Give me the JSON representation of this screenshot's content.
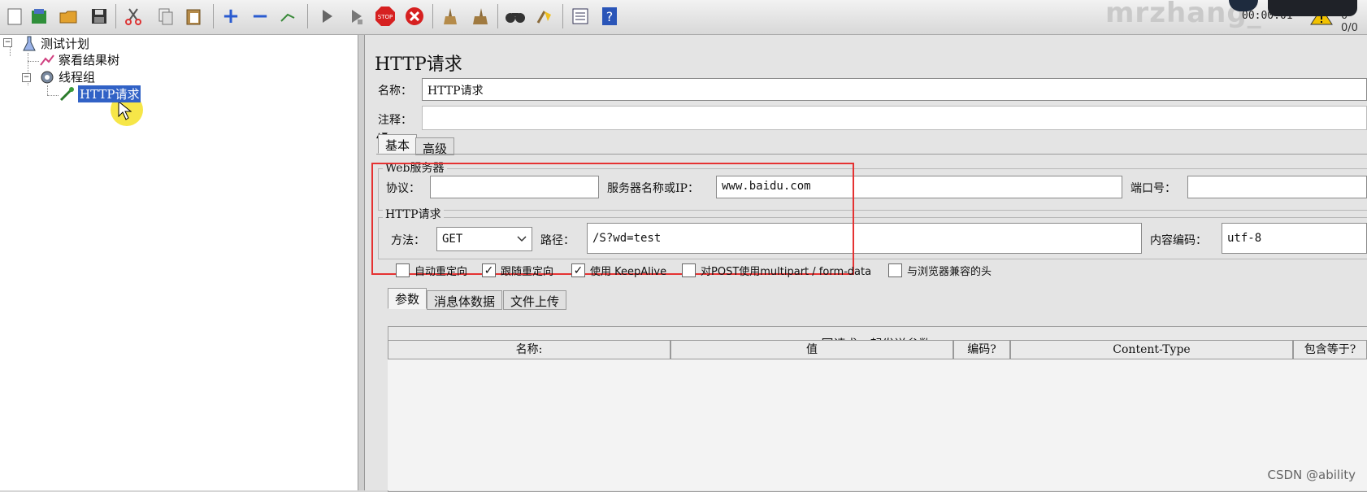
{
  "toolbar": {
    "icons": [
      "new-icon",
      "templates-icon",
      "open-icon",
      "save-icon",
      "cut-icon",
      "copy-icon",
      "paste-icon",
      "expand-icon",
      "collapse-icon",
      "toggle-icon",
      "start-icon",
      "start-no-pause-icon",
      "stop-icon",
      "shutdown-icon",
      "clear-icon",
      "clear-all-icon",
      "search-icon",
      "reset-search-icon",
      "function-helper-icon",
      "help-icon"
    ],
    "timer": "00:00:01",
    "count": "0 0/0",
    "watermark": "mrzhang_"
  },
  "tree": {
    "items": [
      {
        "label": "测试计划",
        "icon": "test-plan-icon"
      },
      {
        "label": "察看结果树",
        "icon": "results-tree-icon"
      },
      {
        "label": "线程组",
        "icon": "thread-group-icon"
      },
      {
        "label": "HTTP请求",
        "icon": "http-sampler-icon"
      }
    ]
  },
  "panel": {
    "title": "HTTP请求",
    "name_label": "名称：",
    "name_value": "HTTP请求",
    "comment_label": "注释：",
    "tabs": [
      "基本",
      "高级"
    ],
    "web_server": {
      "legend": "Web服务器",
      "protocol_label": "协议：",
      "protocol_value": "",
      "server_label": "服务器名称或IP：",
      "server_value": "www.baidu.com",
      "port_label": "端口号：",
      "port_value": ""
    },
    "http_request": {
      "legend": "HTTP请求",
      "method_label": "方法：",
      "method_value": "GET",
      "path_label": "路径：",
      "path_value": "/S?wd=test",
      "encoding_label": "内容编码：",
      "encoding_value": "utf-8"
    },
    "checkboxes": [
      {
        "label": "自动重定向",
        "checked": false
      },
      {
        "label": "跟随重定向",
        "checked": true
      },
      {
        "label": "使用 KeepAlive",
        "checked": true
      },
      {
        "label": "对POST使用multipart / form-data",
        "checked": false
      },
      {
        "label": "与浏览器兼容的头",
        "checked": false
      }
    ],
    "sub_tabs": [
      "参数",
      "消息体数据",
      "文件上传"
    ],
    "params_title": "同请求一起发送参数:",
    "columns": [
      "名称:",
      "值",
      "编码?",
      "Content-Type",
      "包含等于?"
    ]
  },
  "credit": "CSDN @ability"
}
